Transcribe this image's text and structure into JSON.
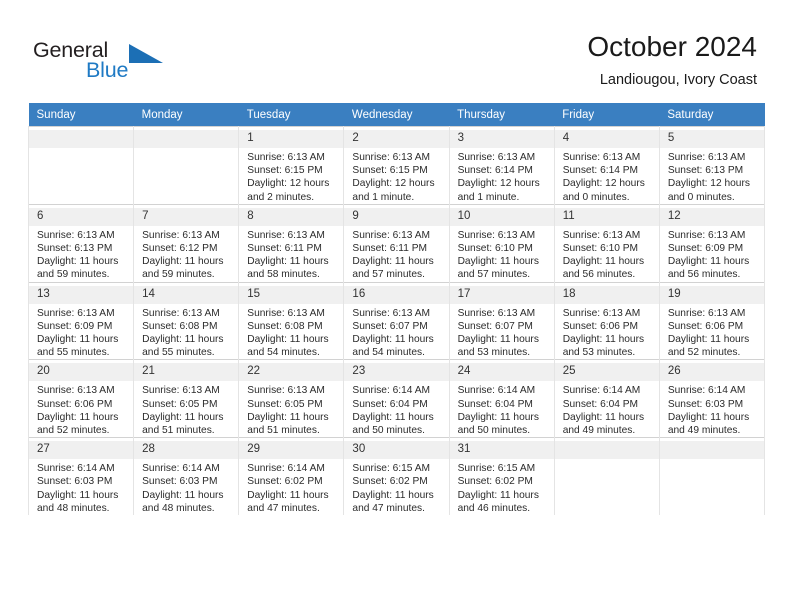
{
  "brand": {
    "name_part1": "General",
    "name_part2": "Blue",
    "triangle_color": "#1c6fb5",
    "blue_color": "#1f7ac4"
  },
  "header": {
    "month_title": "October 2024",
    "location": "Landiougou, Ivory Coast"
  },
  "theme": {
    "header_row_bg": "#3a7fc1",
    "daynum_bg": "#f0f0f0",
    "grid_line": "#e4e4e4"
  },
  "weekdays": [
    "Sunday",
    "Monday",
    "Tuesday",
    "Wednesday",
    "Thursday",
    "Friday",
    "Saturday"
  ],
  "labels": {
    "sunrise_prefix": "Sunrise: ",
    "sunset_prefix": "Sunset: ",
    "daylight_prefix": "Daylight: "
  },
  "weeks": [
    [
      {
        "day": "",
        "empty": true,
        "text": ""
      },
      {
        "day": "",
        "empty": true,
        "text": ""
      },
      {
        "day": "1",
        "empty": false,
        "sunrise": "6:13 AM",
        "sunset": "6:15 PM",
        "daylight": "12 hours and 2 minutes.",
        "text": "Sunrise: 6:13 AM\nSunset: 6:15 PM\nDaylight: 12 hours and 2 minutes."
      },
      {
        "day": "2",
        "empty": false,
        "sunrise": "6:13 AM",
        "sunset": "6:15 PM",
        "daylight": "12 hours and 1 minute.",
        "text": "Sunrise: 6:13 AM\nSunset: 6:15 PM\nDaylight: 12 hours and 1 minute."
      },
      {
        "day": "3",
        "empty": false,
        "sunrise": "6:13 AM",
        "sunset": "6:14 PM",
        "daylight": "12 hours and 1 minute.",
        "text": "Sunrise: 6:13 AM\nSunset: 6:14 PM\nDaylight: 12 hours and 1 minute."
      },
      {
        "day": "4",
        "empty": false,
        "sunrise": "6:13 AM",
        "sunset": "6:14 PM",
        "daylight": "12 hours and 0 minutes.",
        "text": "Sunrise: 6:13 AM\nSunset: 6:14 PM\nDaylight: 12 hours and 0 minutes."
      },
      {
        "day": "5",
        "empty": false,
        "sunrise": "6:13 AM",
        "sunset": "6:13 PM",
        "daylight": "12 hours and 0 minutes.",
        "text": "Sunrise: 6:13 AM\nSunset: 6:13 PM\nDaylight: 12 hours and 0 minutes."
      }
    ],
    [
      {
        "day": "6",
        "empty": false,
        "sunrise": "6:13 AM",
        "sunset": "6:13 PM",
        "daylight": "11 hours and 59 minutes.",
        "text": "Sunrise: 6:13 AM\nSunset: 6:13 PM\nDaylight: 11 hours and 59 minutes."
      },
      {
        "day": "7",
        "empty": false,
        "sunrise": "6:13 AM",
        "sunset": "6:12 PM",
        "daylight": "11 hours and 59 minutes.",
        "text": "Sunrise: 6:13 AM\nSunset: 6:12 PM\nDaylight: 11 hours and 59 minutes."
      },
      {
        "day": "8",
        "empty": false,
        "sunrise": "6:13 AM",
        "sunset": "6:11 PM",
        "daylight": "11 hours and 58 minutes.",
        "text": "Sunrise: 6:13 AM\nSunset: 6:11 PM\nDaylight: 11 hours and 58 minutes."
      },
      {
        "day": "9",
        "empty": false,
        "sunrise": "6:13 AM",
        "sunset": "6:11 PM",
        "daylight": "11 hours and 57 minutes.",
        "text": "Sunrise: 6:13 AM\nSunset: 6:11 PM\nDaylight: 11 hours and 57 minutes."
      },
      {
        "day": "10",
        "empty": false,
        "sunrise": "6:13 AM",
        "sunset": "6:10 PM",
        "daylight": "11 hours and 57 minutes.",
        "text": "Sunrise: 6:13 AM\nSunset: 6:10 PM\nDaylight: 11 hours and 57 minutes."
      },
      {
        "day": "11",
        "empty": false,
        "sunrise": "6:13 AM",
        "sunset": "6:10 PM",
        "daylight": "11 hours and 56 minutes.",
        "text": "Sunrise: 6:13 AM\nSunset: 6:10 PM\nDaylight: 11 hours and 56 minutes."
      },
      {
        "day": "12",
        "empty": false,
        "sunrise": "6:13 AM",
        "sunset": "6:09 PM",
        "daylight": "11 hours and 56 minutes.",
        "text": "Sunrise: 6:13 AM\nSunset: 6:09 PM\nDaylight: 11 hours and 56 minutes."
      }
    ],
    [
      {
        "day": "13",
        "empty": false,
        "sunrise": "6:13 AM",
        "sunset": "6:09 PM",
        "daylight": "11 hours and 55 minutes.",
        "text": "Sunrise: 6:13 AM\nSunset: 6:09 PM\nDaylight: 11 hours and 55 minutes."
      },
      {
        "day": "14",
        "empty": false,
        "sunrise": "6:13 AM",
        "sunset": "6:08 PM",
        "daylight": "11 hours and 55 minutes.",
        "text": "Sunrise: 6:13 AM\nSunset: 6:08 PM\nDaylight: 11 hours and 55 minutes."
      },
      {
        "day": "15",
        "empty": false,
        "sunrise": "6:13 AM",
        "sunset": "6:08 PM",
        "daylight": "11 hours and 54 minutes.",
        "text": "Sunrise: 6:13 AM\nSunset: 6:08 PM\nDaylight: 11 hours and 54 minutes."
      },
      {
        "day": "16",
        "empty": false,
        "sunrise": "6:13 AM",
        "sunset": "6:07 PM",
        "daylight": "11 hours and 54 minutes.",
        "text": "Sunrise: 6:13 AM\nSunset: 6:07 PM\nDaylight: 11 hours and 54 minutes."
      },
      {
        "day": "17",
        "empty": false,
        "sunrise": "6:13 AM",
        "sunset": "6:07 PM",
        "daylight": "11 hours and 53 minutes.",
        "text": "Sunrise: 6:13 AM\nSunset: 6:07 PM\nDaylight: 11 hours and 53 minutes."
      },
      {
        "day": "18",
        "empty": false,
        "sunrise": "6:13 AM",
        "sunset": "6:06 PM",
        "daylight": "11 hours and 53 minutes.",
        "text": "Sunrise: 6:13 AM\nSunset: 6:06 PM\nDaylight: 11 hours and 53 minutes."
      },
      {
        "day": "19",
        "empty": false,
        "sunrise": "6:13 AM",
        "sunset": "6:06 PM",
        "daylight": "11 hours and 52 minutes.",
        "text": "Sunrise: 6:13 AM\nSunset: 6:06 PM\nDaylight: 11 hours and 52 minutes."
      }
    ],
    [
      {
        "day": "20",
        "empty": false,
        "sunrise": "6:13 AM",
        "sunset": "6:06 PM",
        "daylight": "11 hours and 52 minutes.",
        "text": "Sunrise: 6:13 AM\nSunset: 6:06 PM\nDaylight: 11 hours and 52 minutes."
      },
      {
        "day": "21",
        "empty": false,
        "sunrise": "6:13 AM",
        "sunset": "6:05 PM",
        "daylight": "11 hours and 51 minutes.",
        "text": "Sunrise: 6:13 AM\nSunset: 6:05 PM\nDaylight: 11 hours and 51 minutes."
      },
      {
        "day": "22",
        "empty": false,
        "sunrise": "6:13 AM",
        "sunset": "6:05 PM",
        "daylight": "11 hours and 51 minutes.",
        "text": "Sunrise: 6:13 AM\nSunset: 6:05 PM\nDaylight: 11 hours and 51 minutes."
      },
      {
        "day": "23",
        "empty": false,
        "sunrise": "6:14 AM",
        "sunset": "6:04 PM",
        "daylight": "11 hours and 50 minutes.",
        "text": "Sunrise: 6:14 AM\nSunset: 6:04 PM\nDaylight: 11 hours and 50 minutes."
      },
      {
        "day": "24",
        "empty": false,
        "sunrise": "6:14 AM",
        "sunset": "6:04 PM",
        "daylight": "11 hours and 50 minutes.",
        "text": "Sunrise: 6:14 AM\nSunset: 6:04 PM\nDaylight: 11 hours and 50 minutes."
      },
      {
        "day": "25",
        "empty": false,
        "sunrise": "6:14 AM",
        "sunset": "6:04 PM",
        "daylight": "11 hours and 49 minutes.",
        "text": "Sunrise: 6:14 AM\nSunset: 6:04 PM\nDaylight: 11 hours and 49 minutes."
      },
      {
        "day": "26",
        "empty": false,
        "sunrise": "6:14 AM",
        "sunset": "6:03 PM",
        "daylight": "11 hours and 49 minutes.",
        "text": "Sunrise: 6:14 AM\nSunset: 6:03 PM\nDaylight: 11 hours and 49 minutes."
      }
    ],
    [
      {
        "day": "27",
        "empty": false,
        "sunrise": "6:14 AM",
        "sunset": "6:03 PM",
        "daylight": "11 hours and 48 minutes.",
        "text": "Sunrise: 6:14 AM\nSunset: 6:03 PM\nDaylight: 11 hours and 48 minutes."
      },
      {
        "day": "28",
        "empty": false,
        "sunrise": "6:14 AM",
        "sunset": "6:03 PM",
        "daylight": "11 hours and 48 minutes.",
        "text": "Sunrise: 6:14 AM\nSunset: 6:03 PM\nDaylight: 11 hours and 48 minutes."
      },
      {
        "day": "29",
        "empty": false,
        "sunrise": "6:14 AM",
        "sunset": "6:02 PM",
        "daylight": "11 hours and 47 minutes.",
        "text": "Sunrise: 6:14 AM\nSunset: 6:02 PM\nDaylight: 11 hours and 47 minutes."
      },
      {
        "day": "30",
        "empty": false,
        "sunrise": "6:15 AM",
        "sunset": "6:02 PM",
        "daylight": "11 hours and 47 minutes.",
        "text": "Sunrise: 6:15 AM\nSunset: 6:02 PM\nDaylight: 11 hours and 47 minutes."
      },
      {
        "day": "31",
        "empty": false,
        "sunrise": "6:15 AM",
        "sunset": "6:02 PM",
        "daylight": "11 hours and 46 minutes.",
        "text": "Sunrise: 6:15 AM\nSunset: 6:02 PM\nDaylight: 11 hours and 46 minutes."
      },
      {
        "day": "",
        "empty": true,
        "text": ""
      },
      {
        "day": "",
        "empty": true,
        "text": ""
      }
    ]
  ]
}
